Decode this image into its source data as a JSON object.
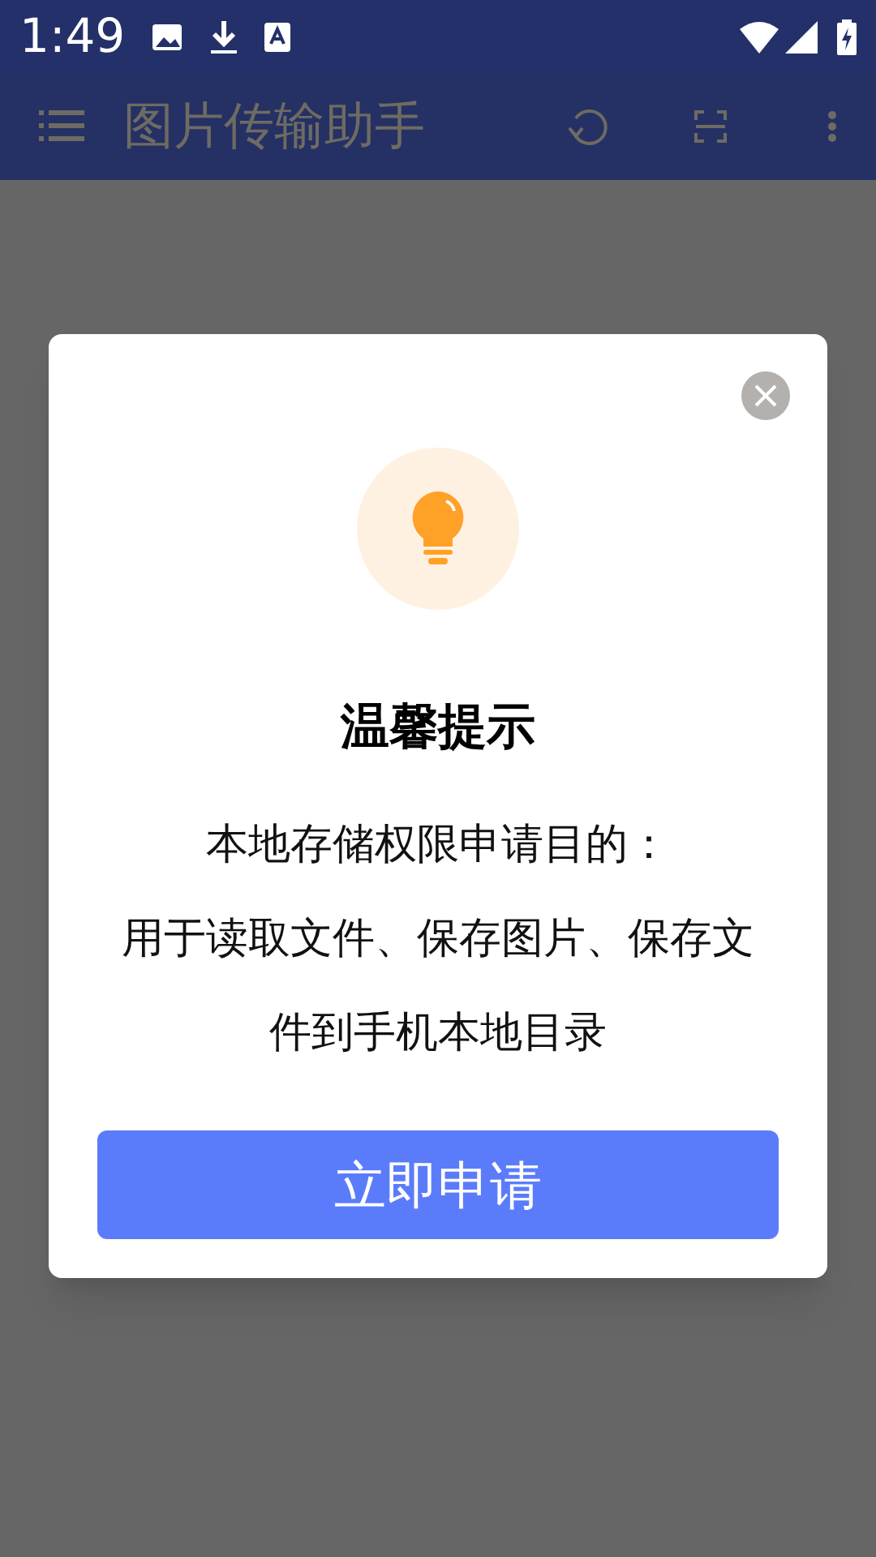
{
  "status_bar": {
    "time": "1:49"
  },
  "app_bar": {
    "title": "图片传输助手"
  },
  "dialog": {
    "title": "温馨提示",
    "message_lines": [
      "本地存储权限申请目的：",
      "用于读取文件、保存图片、保存文件到手机本地目录"
    ],
    "button": "立即申请"
  }
}
